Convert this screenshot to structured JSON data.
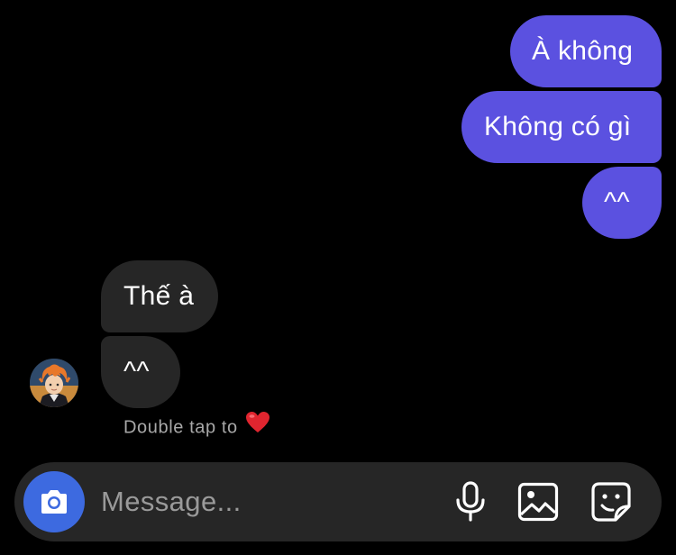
{
  "conversation": {
    "sent": [
      {
        "text": "À không"
      },
      {
        "text": "Không có gì"
      },
      {
        "text": "^^"
      }
    ],
    "received": [
      {
        "text": "Thế à"
      },
      {
        "text": "^^"
      }
    ],
    "hint": {
      "text": "Double tap to",
      "icon": "red-heart"
    }
  },
  "composer": {
    "placeholder": "Message...",
    "icons": [
      "camera-icon",
      "microphone-icon",
      "gallery-icon",
      "sticker-icon"
    ]
  },
  "colors": {
    "sent_bubble": "#5b51e0",
    "received_bubble": "#262626",
    "camera_button": "#3d6ae0",
    "heart": "#e0252f"
  }
}
